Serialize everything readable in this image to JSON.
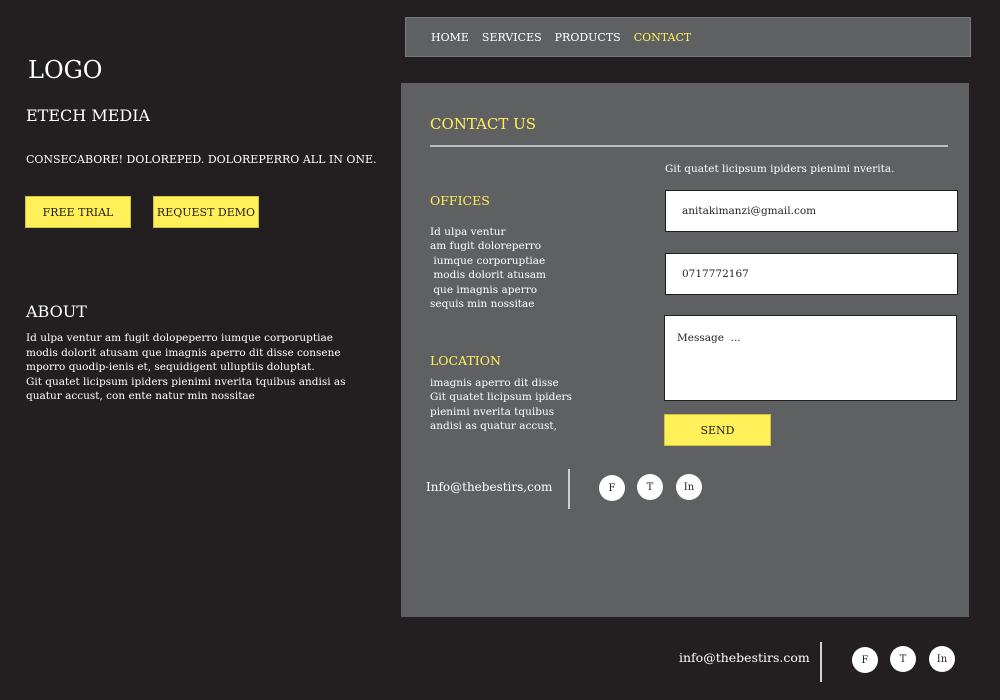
{
  "hero": {
    "logo": "LOGO",
    "brand": "ETECH MEDIA",
    "tagline": "CONSECABORE!  DOLOREPED. DOLOREPERRO ALL IN ONE.",
    "free_trial": "FREE TRIAL",
    "request_demo": "REQUEST DEMO"
  },
  "about": {
    "title": "ABOUT",
    "text": "Id ulpa ventur am fugit dolореperro iumque corporuptiae modis dolorit atusam que imagnis aperro dit disse consene mporro quodip-ienis et, sequidigent ulluptiis doluptat.\nGit quatet licipsum ipiders pienimi nverita tquibus andisi as quatur accust, con ente natur min nossitae"
  },
  "nav": {
    "items": [
      "HOME",
      "SERVICES",
      "PRODUCTS",
      "CONTACT"
    ],
    "active": "CONTACT"
  },
  "contact": {
    "title": "CONTACT US",
    "offices_title": "OFFICES",
    "offices_lines": [
      "Id ulpa ventur",
      "am fugit doloreperro",
      " iumque corporuptiae",
      " modis dolorit atusam",
      " que imagnis aperro",
      "sequis min nossitae"
    ],
    "location_title": "LOCATION",
    "location_lines": [
      "imagnis aperro dit disse",
      "Git quatet licipsum ipiders",
      "pienimi nverita tquibus",
      "andisi as quatur accust,"
    ],
    "form_intro": "Git quatet licipsum ipiders pienimi nverita.",
    "email_value": "anitakimanzi@gmail.com",
    "phone_value": "0717772167",
    "message_placeholder": "Message  ...",
    "send_label": "SEND",
    "contact_email": "Info@thebestirs,com",
    "social": {
      "facebook": "F",
      "twitter": "T",
      "linkedin": "In"
    }
  },
  "footer": {
    "email": "info@thebestirs.com",
    "social": {
      "facebook": "F",
      "twitter": "T",
      "linkedin": "In"
    }
  },
  "colors": {
    "background": "#231f20",
    "panel": "#5f6062",
    "accent": "#fff05a"
  },
  "icons": [
    "facebook-icon",
    "twitter-icon",
    "linkedin-icon"
  ]
}
